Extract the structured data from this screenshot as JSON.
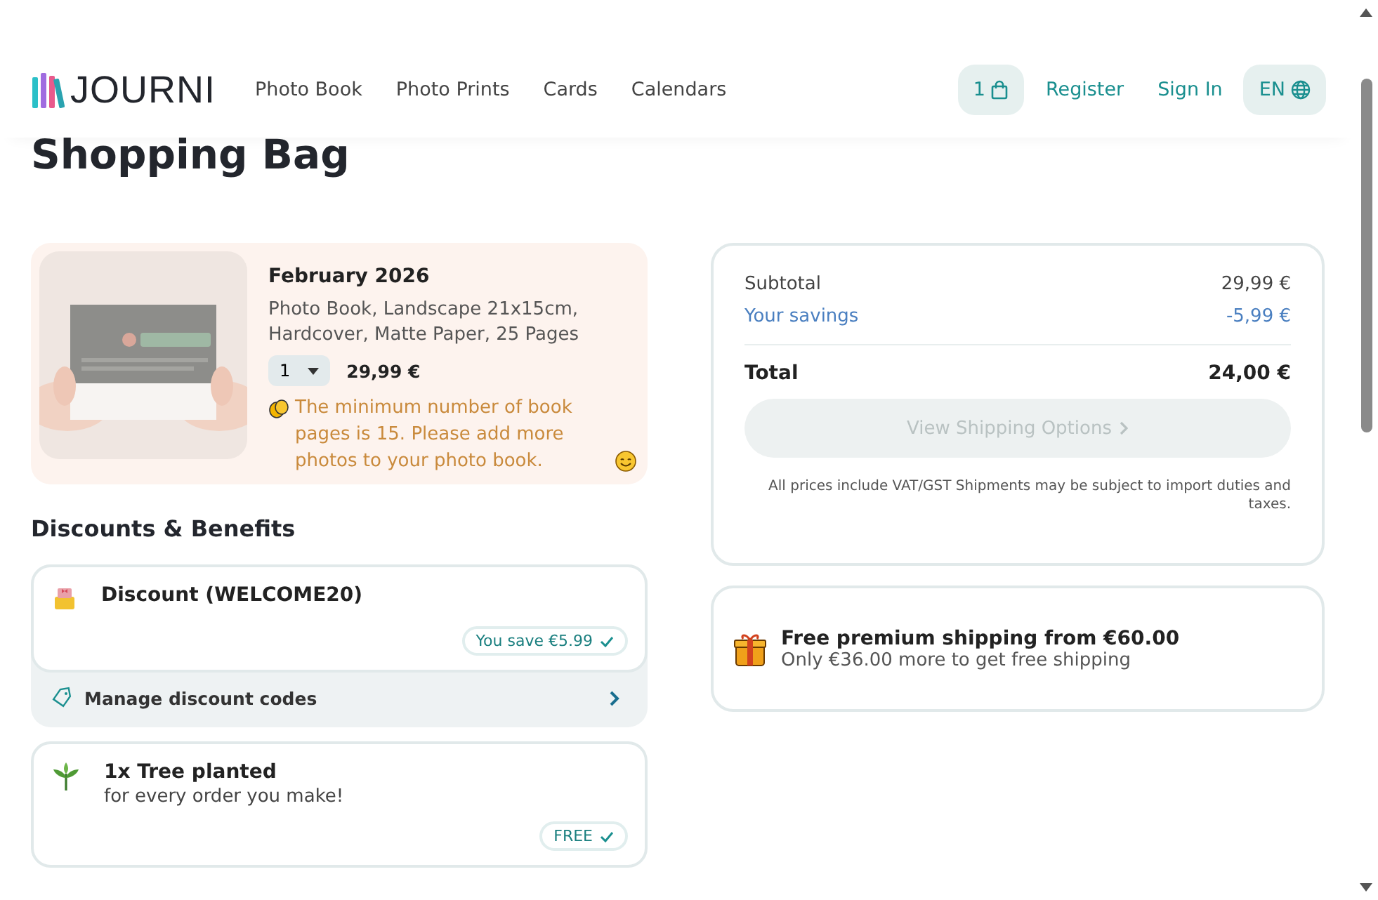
{
  "header": {
    "logo": "JOURNI",
    "nav": [
      "Photo Book",
      "Photo Prints",
      "Cards",
      "Calendars"
    ],
    "cart_count": "1",
    "register": "Register",
    "sign_in": "Sign In",
    "language": "EN"
  },
  "page_title": "Shopping Bag",
  "cart_item": {
    "title": "February 2026",
    "description": "Photo Book, Landscape 21x15cm, Hardcover, Matte Paper, 25 Pages",
    "quantity": "1",
    "price": "29,99 €",
    "warning": "The minimum number of book pages is 15. Please add more photos to your photo book."
  },
  "discounts": {
    "heading": "Discounts & Benefits",
    "items": [
      {
        "title": "Discount (WELCOME20)",
        "badge": "You save €5.99",
        "kind": "gift"
      },
      {
        "title": "1x Tree planted",
        "subtitle": "for every order you make!",
        "badge": "FREE",
        "kind": "tree"
      }
    ],
    "manage": "Manage discount codes"
  },
  "summary": {
    "rows": [
      {
        "label": "Subtotal",
        "value": "29,99 €",
        "kind": "plain"
      },
      {
        "label": "Your savings",
        "value": "-5,99 €",
        "kind": "savings"
      },
      {
        "label": "Total",
        "value": "24,00 €",
        "kind": "total"
      }
    ],
    "button": {
      "label": "View Shipping Options",
      "disabled": true
    },
    "note": "All prices include VAT/GST Shipments may be subject to import duties and taxes."
  },
  "shipping": {
    "title": "Free premium shipping from €60.00",
    "subtitle": "Only €36.00 more to get free shipping"
  }
}
